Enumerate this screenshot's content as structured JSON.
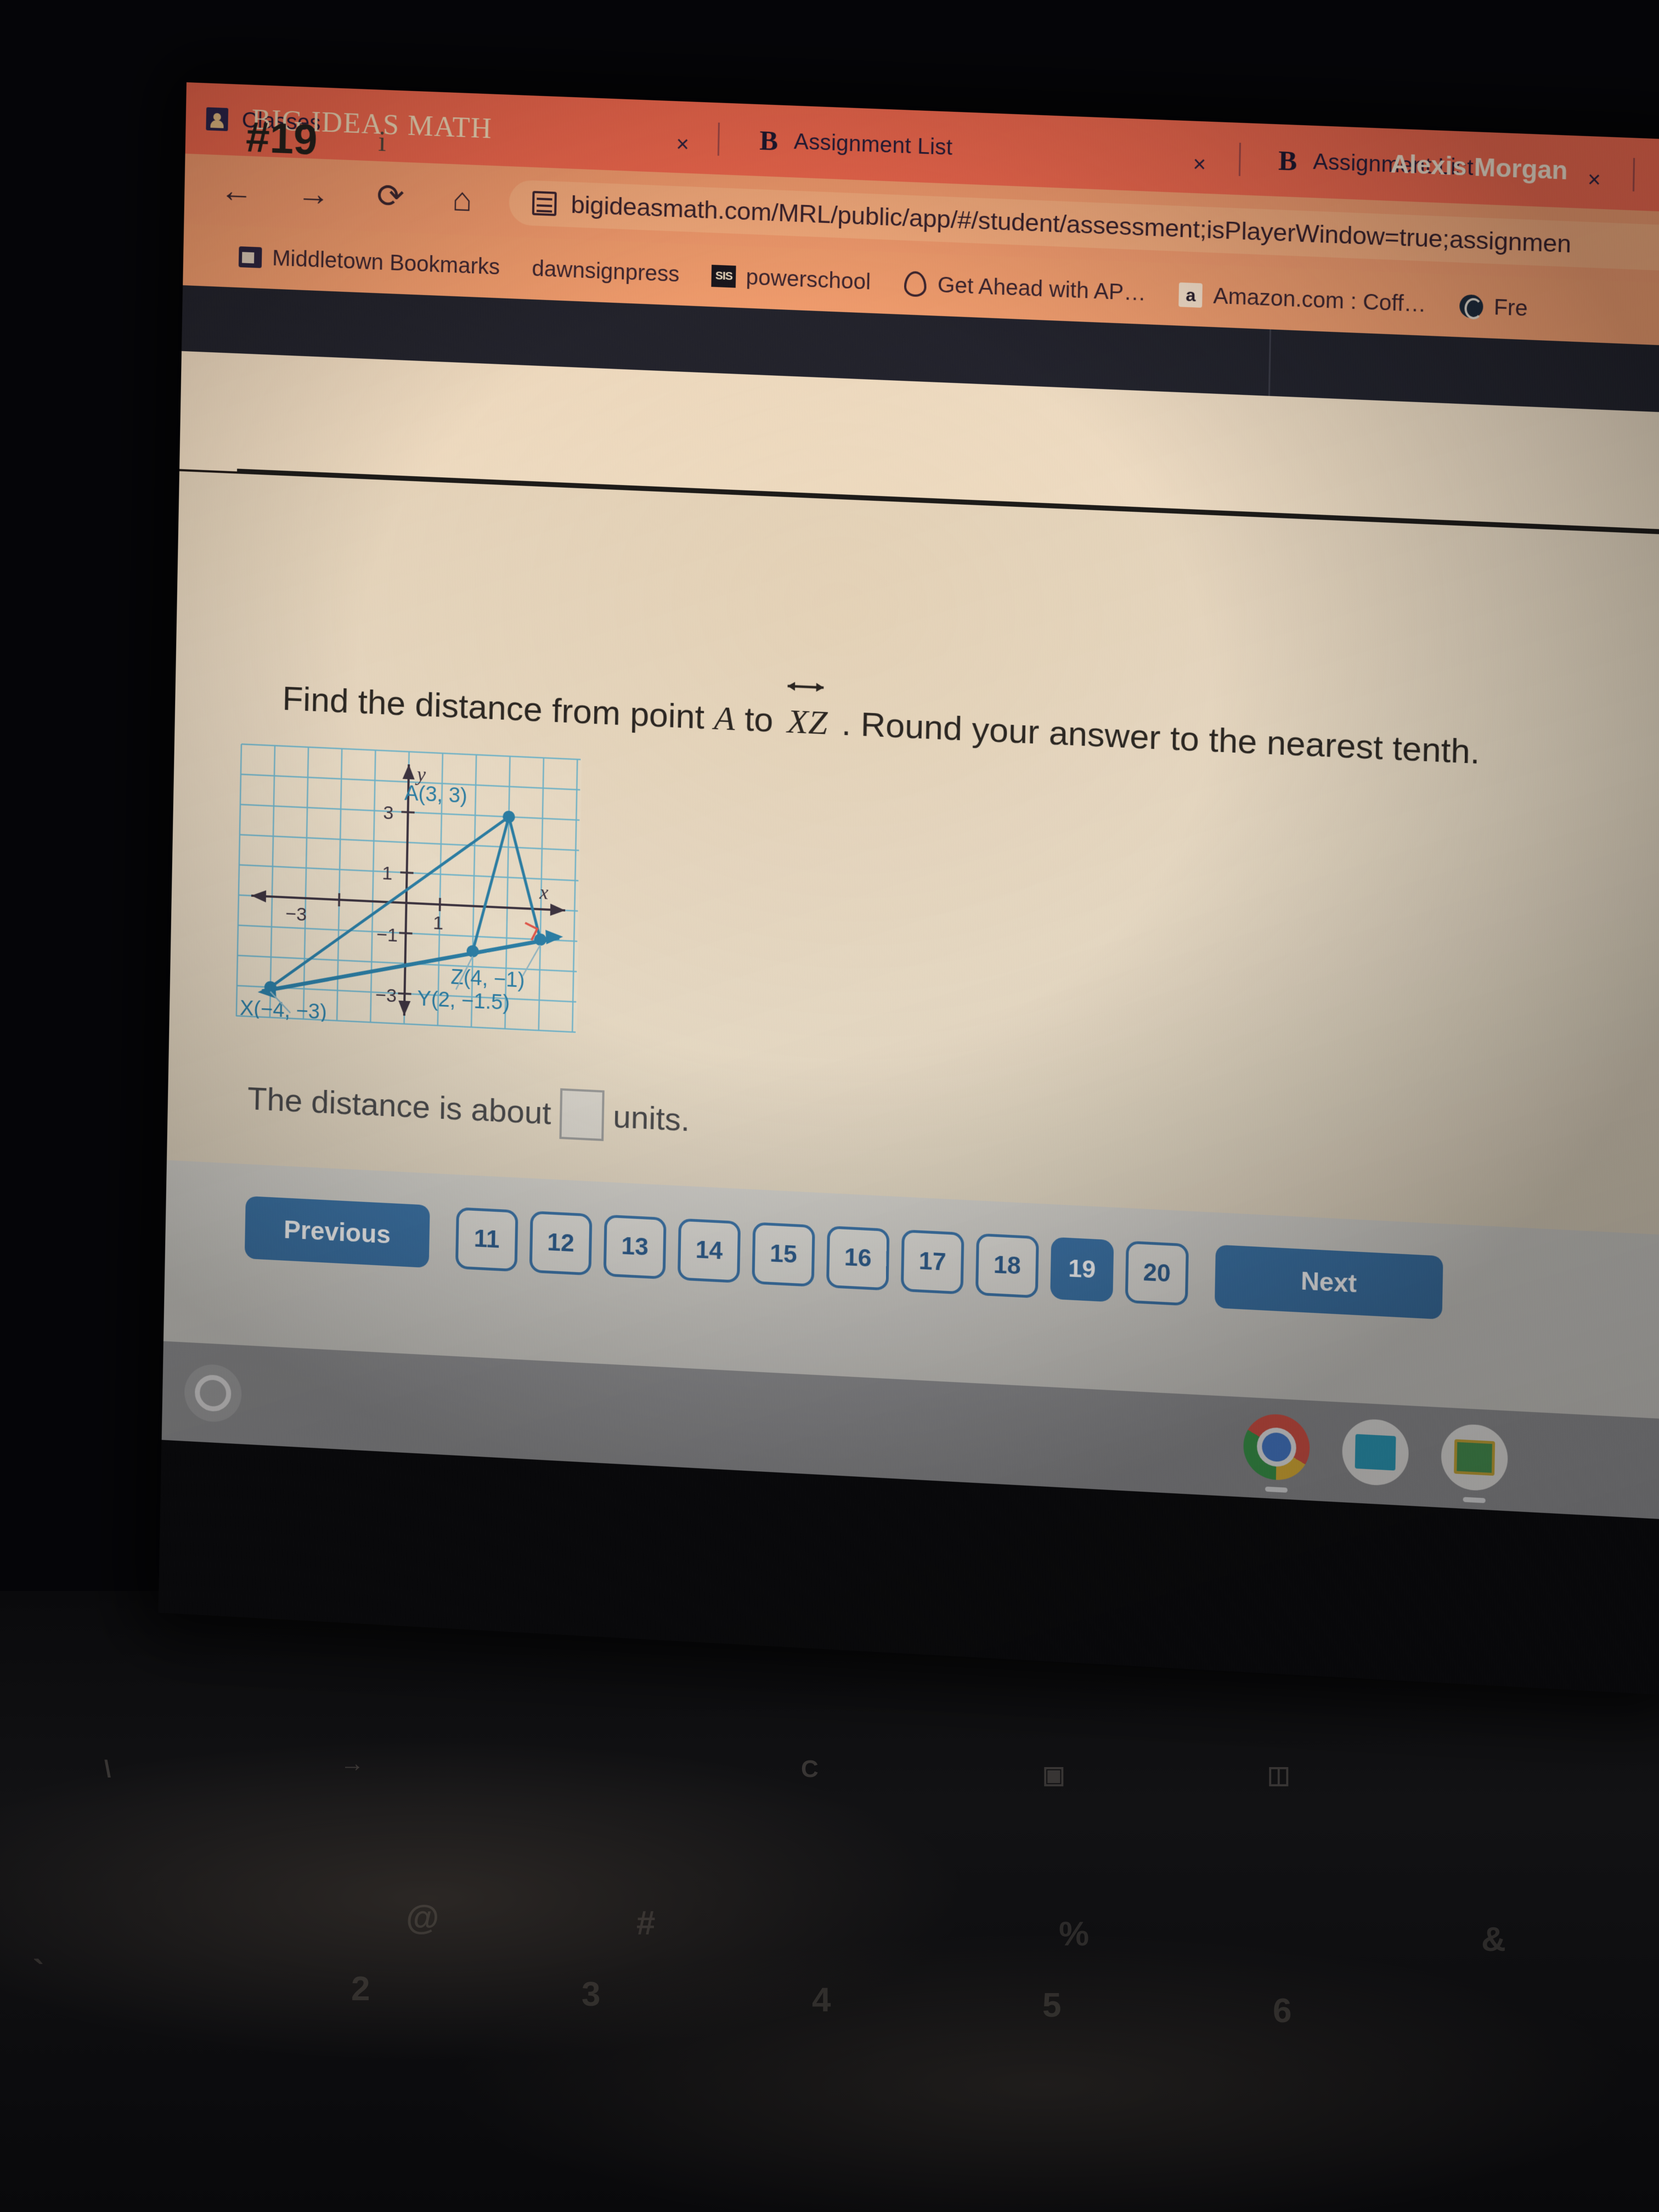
{
  "browser": {
    "tabs": [
      {
        "title": "Classes",
        "favicon": "classes-icon",
        "close_label": "×"
      },
      {
        "title": "Assignment List",
        "favicon": "bigideas-b-icon",
        "close_label": "×"
      },
      {
        "title": "Assignment List",
        "favicon": "bigideas-b-icon",
        "close_label": "×"
      },
      {
        "title": "",
        "favicon": "bigideas-b-icon",
        "close_label": ""
      }
    ],
    "nav": {
      "back": "←",
      "forward": "→",
      "reload": "⟳",
      "home": "⌂"
    },
    "omnibox": {
      "url": "bigideasmath.com/MRL/public/app/#/student/assessment;isPlayerWindow=true;assignmen",
      "site_icon": "site-info-icon"
    },
    "bookmarks": [
      {
        "label": "Middletown Bookmarks",
        "icon": "folder-icon"
      },
      {
        "label": "dawnsignpress",
        "icon": "none"
      },
      {
        "label": "powerschool",
        "icon": "sis-icon"
      },
      {
        "label": "Get Ahead with AP…",
        "icon": "acorn-icon"
      },
      {
        "label": "Amazon.com : Coff…",
        "icon": "amazon-icon"
      },
      {
        "label": "Fre",
        "icon": "globe-icon"
      }
    ]
  },
  "app": {
    "brand": "BIG IDEAS MATH",
    "user": "Alexis Morgan",
    "question_number": "#19",
    "info_icon_label": "i",
    "question": {
      "prefix": "Find the distance from point ",
      "point": "A",
      "to": " to ",
      "line": "XZ",
      "suffix": " . Round your answer to the nearest tenth."
    },
    "answer": {
      "prefix": "The distance is about",
      "value": "",
      "suffix": "units."
    },
    "pager": {
      "previous": "Previous",
      "next": "Next",
      "pages": [
        "11",
        "12",
        "13",
        "14",
        "15",
        "16",
        "17",
        "18",
        "19",
        "20"
      ],
      "active": "19"
    }
  },
  "chart_data": {
    "type": "scatter",
    "title": "",
    "xlabel": "x",
    "ylabel": "y",
    "xlim": [
      -5,
      5
    ],
    "ylim": [
      -4,
      4
    ],
    "grid": true,
    "xticks": [
      -3,
      1
    ],
    "yticks": [
      3,
      1,
      -1,
      -3
    ],
    "xtick_labels": [
      "-3",
      "1"
    ],
    "ytick_labels": [
      "3",
      "1",
      "-1",
      "-3"
    ],
    "points": [
      {
        "label": "A(3, 3)",
        "name": "A",
        "x": 3,
        "y": 3
      },
      {
        "label": "Z(4, -1)",
        "name": "Z",
        "x": 4,
        "y": -1
      },
      {
        "label": "Y(2, -1.5)",
        "name": "Y",
        "x": 2,
        "y": -1.5
      },
      {
        "label": "X(-4, -3)",
        "name": "X",
        "x": -4,
        "y": -3
      }
    ],
    "segments": [
      {
        "from": "X",
        "to": "A",
        "note": "line through X and A extended"
      },
      {
        "from": "A",
        "to": "Y",
        "note": "segment A to Y"
      },
      {
        "from": "A",
        "to": "perp_foot",
        "note": "perpendicular from A to line XZ"
      },
      {
        "from": "X",
        "to": "Z",
        "note": "line XZ with arrowheads on both ends"
      }
    ],
    "annotations": [
      {
        "type": "right-angle-marker",
        "color": "#e0584c",
        "at": "foot of perpendicular from A to line XZ"
      }
    ],
    "colors": {
      "graph_line": "#2b7fa8",
      "grid": "#6fb6cf",
      "axis": "#403a44",
      "right_angle": "#e0584c"
    }
  },
  "shelf": {
    "launcher": "launcher-button",
    "apps": [
      {
        "name": "chrome-app",
        "running": true
      },
      {
        "name": "clever-app",
        "running": false
      },
      {
        "name": "classroom-app",
        "running": true
      }
    ]
  }
}
